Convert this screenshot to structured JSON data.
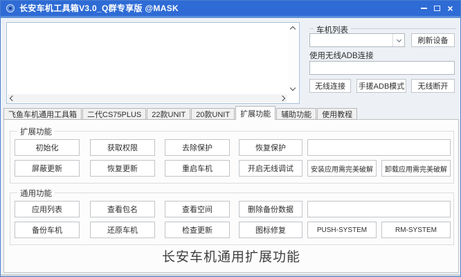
{
  "window": {
    "title": "长安车机工具箱V3.0_Q群专享版 @MASK",
    "icon": "app-logo-circle-icon",
    "controls": {
      "minimize": "minimize-icon",
      "maximize": "maximize-icon",
      "close": "×"
    }
  },
  "colors": {
    "titlebar": "#2e6bd5",
    "titlebar_accent": "#5b8fd9",
    "window_border": "#4a7ed0",
    "client_bg": "#edf1f6",
    "page_bg": "#fcfcfc",
    "button_border": "#c0c4c8"
  },
  "log_panel": {
    "content": ""
  },
  "device_panel": {
    "group_label": "车机列表",
    "device_select_value": "",
    "refresh_button": "刷新设备",
    "adb_label": "使用无线ADB连接",
    "adb_input_value": "",
    "connect_button": "无线连接",
    "manual_adb_button": "手搓ADB模式",
    "disconnect_button": "无线断开"
  },
  "tabs": [
    {
      "label": "飞鱼车机通用工具箱",
      "selected": false
    },
    {
      "label": "二代CS75PLUS",
      "selected": false
    },
    {
      "label": "22款UNIT",
      "selected": false
    },
    {
      "label": "20款UNIT",
      "selected": false
    },
    {
      "label": "扩展功能",
      "selected": true
    },
    {
      "label": "辅助功能",
      "selected": false
    },
    {
      "label": "使用教程",
      "selected": false
    }
  ],
  "extended_group": {
    "label": "扩展功能",
    "row1": [
      "初始化",
      "获取权限",
      "去除保护",
      "恢复保护"
    ],
    "row1_blank": "",
    "row2": [
      "屏蔽更新",
      "恢复更新",
      "重启车机",
      "开启无线调试",
      "安装应用需完美破解",
      "卸载应用需完美破解"
    ]
  },
  "general_group": {
    "label": "通用功能",
    "row1": [
      "应用列表",
      "查看包名",
      "查看空间",
      "删除备份数据"
    ],
    "row1_blank": "",
    "row2": [
      "备份车机",
      "还原车机",
      "检查更新",
      "图标修复",
      "PUSH-SYSTEM",
      "RM-SYSTEM"
    ]
  },
  "footer": {
    "banner": "长安车机通用扩展功能"
  }
}
